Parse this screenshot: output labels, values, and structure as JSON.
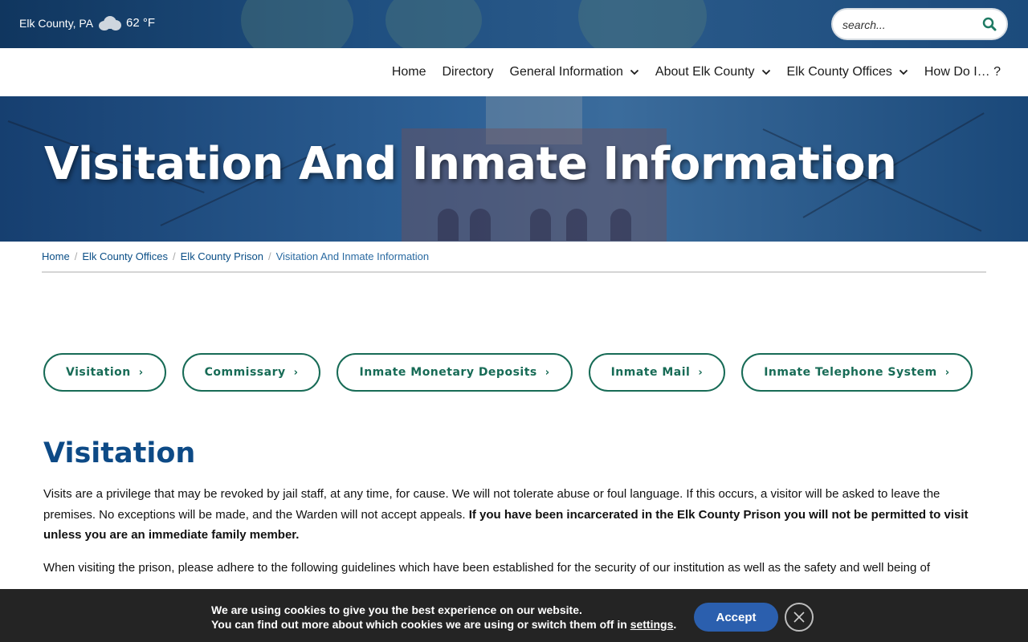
{
  "topbar": {
    "location": "Elk County, PA",
    "temperature": "62 °F",
    "weather_icon": "cloud-icon",
    "search_placeholder": "search..."
  },
  "nav": {
    "items": [
      {
        "label": "Home",
        "dropdown": false
      },
      {
        "label": "Directory",
        "dropdown": false
      },
      {
        "label": "General Information",
        "dropdown": true
      },
      {
        "label": "About Elk County",
        "dropdown": true
      },
      {
        "label": "Elk County Offices",
        "dropdown": true
      },
      {
        "label": "How Do I… ?",
        "dropdown": false
      }
    ]
  },
  "hero": {
    "title": "Visitation And Inmate Information"
  },
  "breadcrumb": {
    "items": [
      "Home",
      "Elk County Offices",
      "Elk County Prison"
    ],
    "current": "Visitation And Inmate Information",
    "separator": "/"
  },
  "sections": {
    "buttons": [
      "Visitation",
      "Commissary",
      "Inmate Monetary Deposits",
      "Inmate Mail",
      "Inmate Telephone System"
    ],
    "arrow": "›"
  },
  "content": {
    "heading": "Visitation",
    "p1_text": "Visits are a privilege that may be revoked by jail staff, at any time, for cause. We will not tolerate abuse or foul language. If this occurs, a visitor will be asked to leave the premises. No exceptions will be made, and the Warden will not accept appeals. ",
    "p1_bold": "If you have been incarcerated in the Elk County Prison you will not be permitted to visit unless you are an immediate family member.",
    "p2_text": "When visiting the prison, please adhere to the following guidelines which have been established for the security of our institution as well as the safety and well being of"
  },
  "cookie": {
    "line1": "We are using cookies to give you the best experience on our website.",
    "line2_prefix": "You can find out more about which cookies we are using or switch them off in ",
    "line2_link": "settings",
    "line2_suffix": ".",
    "accept_label": "Accept"
  },
  "colors": {
    "brand_blue": "#0d4a86",
    "accent_green": "#176b56",
    "accept_blue": "#2b5fae",
    "cookie_bg": "#242424"
  }
}
